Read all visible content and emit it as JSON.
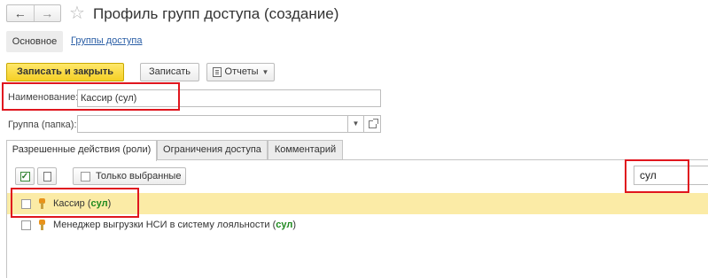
{
  "window": {
    "title": "Профиль групп доступа (создание)",
    "back_icon": "arrow-left-icon",
    "forward_icon": "arrow-right-icon",
    "favorite_icon": "star-icon"
  },
  "sections": {
    "main": "Основное",
    "link": "Группы доступа"
  },
  "toolbar": {
    "save_close": "Записать и закрыть",
    "save": "Записать",
    "reports": "Отчеты"
  },
  "form": {
    "name_label": "Наименование:",
    "name_value": "Кассир (сул)",
    "group_label": "Группа (папка):",
    "group_value": ""
  },
  "tabs": [
    {
      "label": "Разрешенные действия (роли)"
    },
    {
      "label": "Ограничения доступа"
    },
    {
      "label": "Комментарий"
    }
  ],
  "roles_toolbar": {
    "only_selected": "Только выбранные",
    "search_value": "сул"
  },
  "roles": [
    {
      "prefix": "Кассир (",
      "match": "сул",
      "suffix": ")",
      "checked": false,
      "selected": true
    },
    {
      "prefix": "Менеджер выгрузки НСИ в систему лояльности (",
      "match": "сул",
      "suffix": ")",
      "checked": false,
      "selected": false
    }
  ],
  "colors": {
    "primary_button": "#f5cf25",
    "highlight_row": "#fbeba6",
    "match_text": "#1f8a1f",
    "annotation_box": "#e0161e",
    "link": "#2b5fa6"
  }
}
